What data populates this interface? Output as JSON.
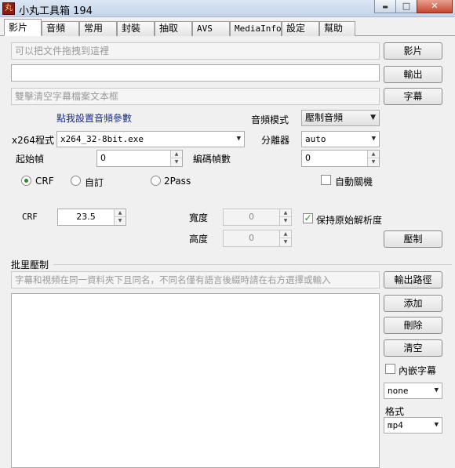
{
  "window": {
    "title": "小丸工具箱 194",
    "icon_glyph": "丸",
    "min_glyph": "▬",
    "max_glyph": "□",
    "close_glyph": "✕"
  },
  "tabs": [
    "影片",
    "音頻",
    "常用",
    "封裝",
    "抽取",
    "AVS",
    "MediaInfo",
    "設定",
    "幫助"
  ],
  "video": {
    "drop_video_placeholder": "可以把文件拖拽到這裡",
    "output_path": "",
    "subtitle_placeholder": "雙擊清空字幕檔案文本框",
    "video_button": "影片",
    "output_button": "輸出",
    "subtitle_button": "字幕",
    "audio_params_link": "點我設置音頻參數",
    "audio_mode_label": "音頻模式",
    "audio_mode_value": "壓制音頻",
    "x264_label": "x264程式",
    "x264_value": "x264_32-8bit.exe",
    "demuxer_label": "分離器",
    "demuxer_value": "auto",
    "start_frame_label": "起始幀",
    "start_frame_value": "0",
    "encode_frames_label": "編碼幀數",
    "encode_frames_value": "0",
    "mode_crf": "CRF",
    "mode_custom": "自訂",
    "mode_2pass": "2Pass",
    "auto_shutdown_label": "自動關機",
    "crf_label": "CRF",
    "crf_value": "23.5",
    "width_label": "寬度",
    "width_value": "0",
    "height_label": "高度",
    "height_value": "0",
    "keep_resolution_label": "保持原始解析度",
    "keep_resolution_checked": true,
    "encode_button": "壓制"
  },
  "batch": {
    "section_title": "批里壓制",
    "hint_placeholder": "字幕和視頻在同一資料夾下且同名，不同名僅有語言後綴時請在右方選擇或輸入",
    "output_path_button": "輸出路徑",
    "add_button": "添加",
    "delete_button": "刪除",
    "clear_button": "清空",
    "embed_subtitle_label": "內嵌字幕",
    "embed_subtitle_checked": false,
    "subtitle_lang_value": "none",
    "format_label": "格式",
    "format_value": "mp4"
  }
}
